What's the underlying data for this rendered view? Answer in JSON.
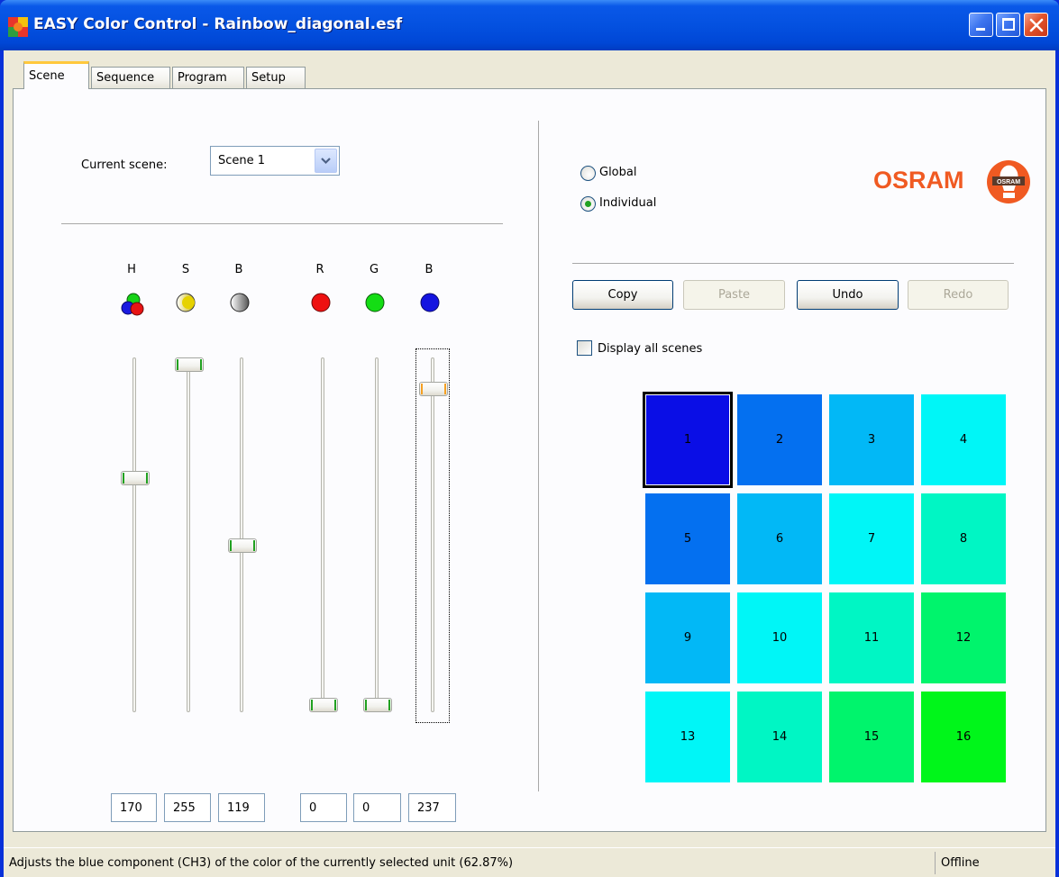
{
  "window": {
    "title": "EASY Color Control - Rainbow_diagonal.esf",
    "icon": "app-color-icon",
    "controls": [
      "minimize-icon",
      "maximize-icon",
      "close-icon"
    ]
  },
  "tabs": [
    {
      "label": "Scene",
      "active": true
    },
    {
      "label": "Sequence",
      "active": false
    },
    {
      "label": "Program",
      "active": false
    },
    {
      "label": "Setup",
      "active": false
    }
  ],
  "scene": {
    "current_label": "Current scene:",
    "current_value": "Scene 1"
  },
  "channels": [
    {
      "label": "H",
      "icon": "hue-icon",
      "value": "170",
      "level": 0.667
    },
    {
      "label": "S",
      "icon": "saturation-icon",
      "value": "255",
      "level": 1.0
    },
    {
      "label": "B",
      "icon": "brightness-icon",
      "value": "119",
      "level": 0.467
    },
    {
      "label": "R",
      "icon": "red-icon",
      "value": "0",
      "level": 0.0
    },
    {
      "label": "G",
      "icon": "green-icon",
      "value": "0",
      "level": 0.0
    },
    {
      "label": "B",
      "icon": "blue-icon",
      "value": "237",
      "level": 0.929
    }
  ],
  "mode": {
    "global_label": "Global",
    "individual_label": "Individual",
    "selected": "Individual"
  },
  "actions": {
    "copy": "Copy",
    "paste": "Paste",
    "undo": "Undo",
    "redo": "Redo"
  },
  "display_all_scenes": {
    "label": "Display all scenes",
    "checked": false
  },
  "grid": [
    {
      "label": "1",
      "color": "#0a0ee6",
      "selected": true
    },
    {
      "label": "2",
      "color": "#0470f0"
    },
    {
      "label": "3",
      "color": "#02b8f6"
    },
    {
      "label": "4",
      "color": "#00f6f7"
    },
    {
      "label": "5",
      "color": "#0470f0"
    },
    {
      "label": "6",
      "color": "#02b8f6"
    },
    {
      "label": "7",
      "color": "#00f6f7"
    },
    {
      "label": "8",
      "color": "#00f6c4"
    },
    {
      "label": "9",
      "color": "#02b8f6"
    },
    {
      "label": "10",
      "color": "#00f6f7"
    },
    {
      "label": "11",
      "color": "#00f6c4"
    },
    {
      "label": "12",
      "color": "#00f46c"
    },
    {
      "label": "13",
      "color": "#00f6f7"
    },
    {
      "label": "14",
      "color": "#00f6c4"
    },
    {
      "label": "15",
      "color": "#00f46c"
    },
    {
      "label": "16",
      "color": "#00f61a"
    }
  ],
  "brand": {
    "name": "OSRAM",
    "color": "#f05a22"
  },
  "status": {
    "message": "Adjusts the blue component (CH3) of the color of the currently selected unit (62.87%)",
    "connection": "Offline"
  }
}
